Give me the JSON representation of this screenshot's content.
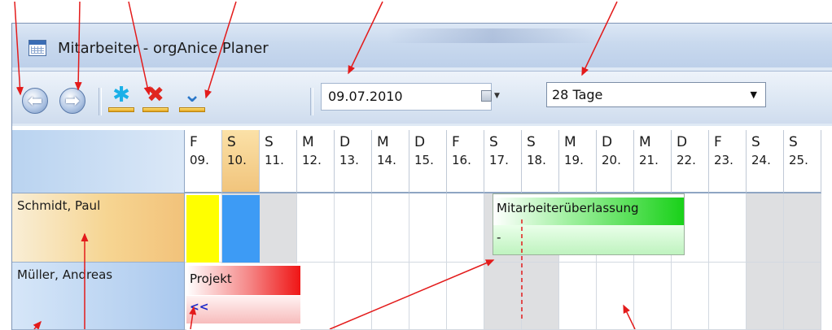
{
  "window": {
    "title": "Mitarbeiter - orgAnice Planer"
  },
  "toolbar": {
    "date_value": "09.07.2010",
    "range_value": "28 Tage"
  },
  "icons": {
    "back": "left-arrow-icon",
    "forward": "right-arrow-icon",
    "new": "new-star-icon",
    "delete": "delete-x-icon",
    "down": "move-down-icon",
    "calendar": "calendar-icon"
  },
  "days": [
    {
      "wd": "F",
      "dn": "09."
    },
    {
      "wd": "S",
      "dn": "10."
    },
    {
      "wd": "S",
      "dn": "11."
    },
    {
      "wd": "M",
      "dn": "12."
    },
    {
      "wd": "D",
      "dn": "13."
    },
    {
      "wd": "M",
      "dn": "14."
    },
    {
      "wd": "D",
      "dn": "15."
    },
    {
      "wd": "F",
      "dn": "16."
    },
    {
      "wd": "S",
      "dn": "17."
    },
    {
      "wd": "S",
      "dn": "18."
    },
    {
      "wd": "M",
      "dn": "19."
    },
    {
      "wd": "D",
      "dn": "20."
    },
    {
      "wd": "M",
      "dn": "21."
    },
    {
      "wd": "D",
      "dn": "22."
    },
    {
      "wd": "F",
      "dn": "23."
    },
    {
      "wd": "S",
      "dn": "24."
    },
    {
      "wd": "S",
      "dn": "25."
    }
  ],
  "employees": [
    {
      "name": "Schmidt, Paul"
    },
    {
      "name": "Müller, Andreas"
    }
  ],
  "events": {
    "green": {
      "title": "Mitarbeiterüberlassung",
      "sub": "-"
    },
    "red": {
      "title": "Projekt",
      "sub": "<<"
    }
  },
  "colors": {
    "selected_day": "#f1c47c",
    "weekend": "#dedfe1",
    "annotation_arrow": "#e31b1b"
  }
}
